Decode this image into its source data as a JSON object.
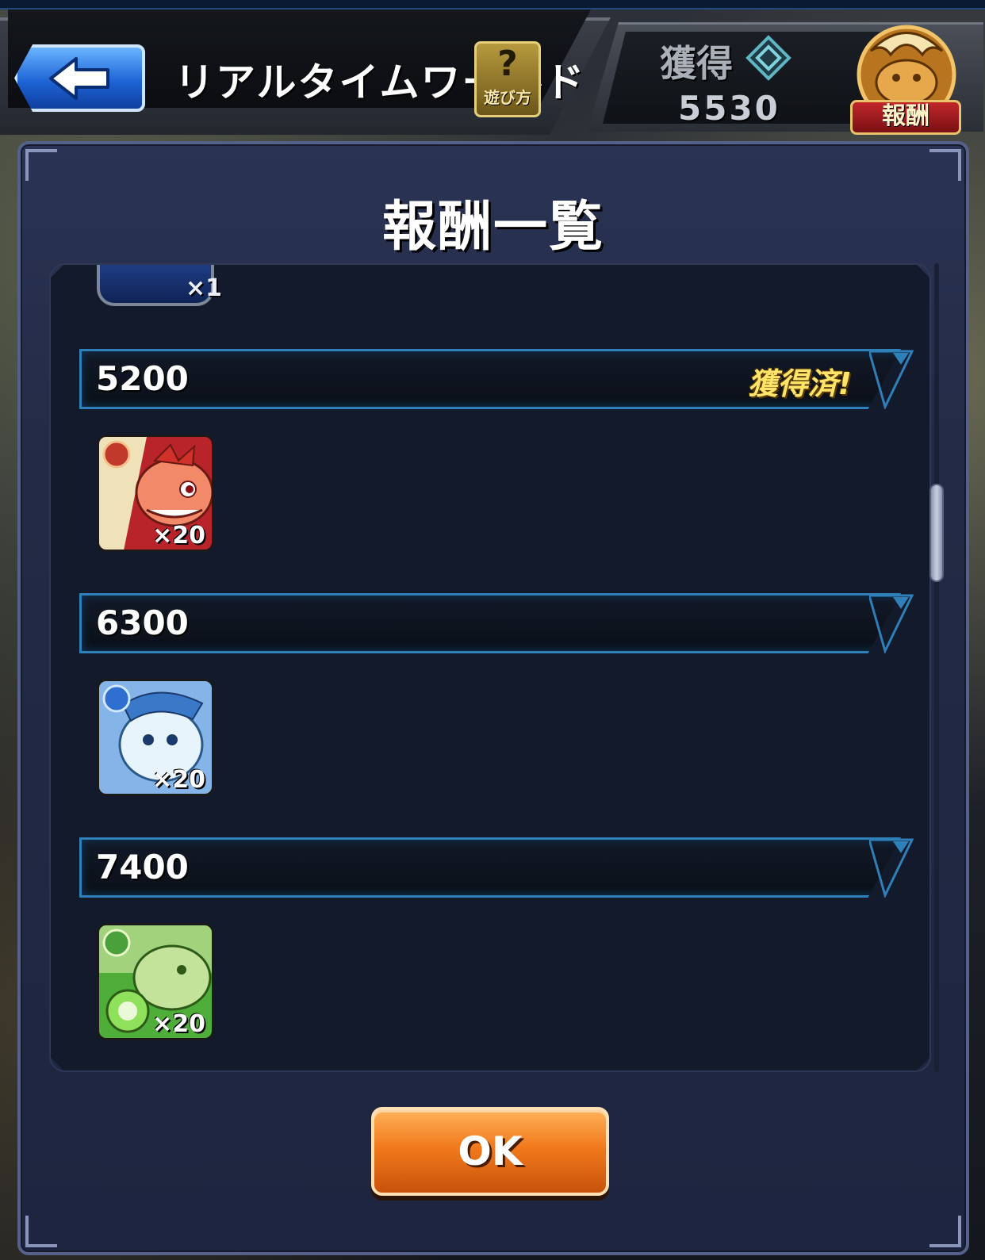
{
  "header": {
    "title": "リアルタイムワールド",
    "help_label": "遊び方",
    "help_glyph": "?"
  },
  "earned": {
    "label": "獲得",
    "value": "5530",
    "reward_badge_label": "報酬"
  },
  "modal": {
    "title": "報酬一覧",
    "partial_item_qty": "×1",
    "tiers": [
      {
        "threshold": "5200",
        "claimed_label": "獲得済!",
        "item_qty": "×20",
        "item_color": "red"
      },
      {
        "threshold": "6300",
        "claimed_label": "",
        "item_qty": "×20",
        "item_color": "blue"
      },
      {
        "threshold": "7400",
        "claimed_label": "",
        "item_qty": "×20",
        "item_color": "green"
      }
    ],
    "ok_label": "OK"
  },
  "colors": {
    "accent_blue": "#2f7fb8",
    "ok_orange": "#f27a1c",
    "claimed_gold": "#ffe46a"
  },
  "icons": [
    "back-arrow-icon",
    "help-icon",
    "diamond-icon",
    "reward-badge-icon"
  ]
}
